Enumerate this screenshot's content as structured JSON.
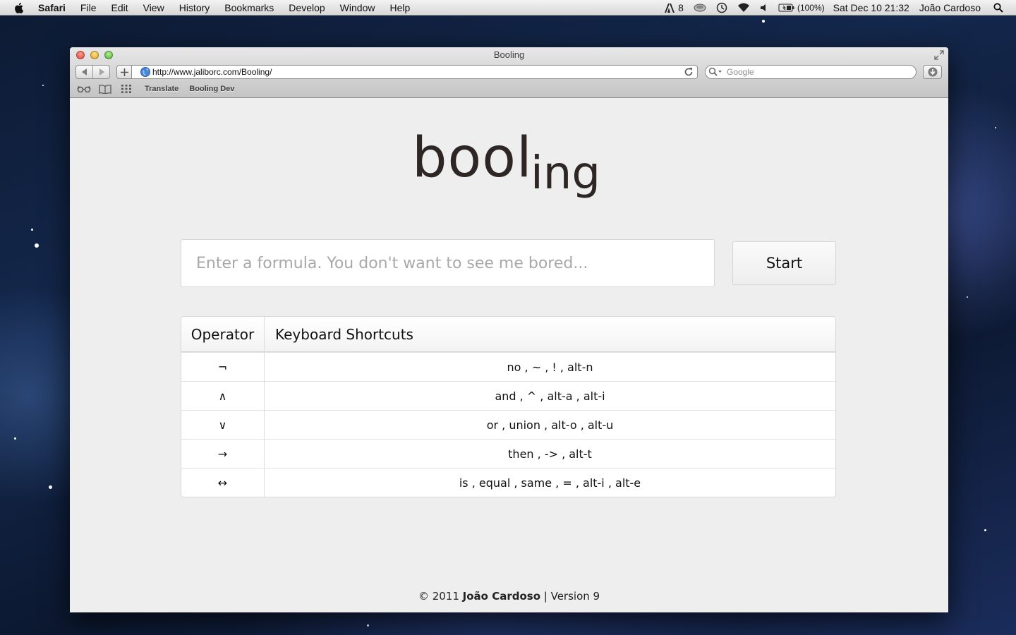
{
  "menubar": {
    "app_name": "Safari",
    "items": [
      "File",
      "Edit",
      "View",
      "History",
      "Bookmarks",
      "Develop",
      "Window",
      "Help"
    ],
    "status": {
      "adobe_count": "8",
      "battery": "(100%)",
      "clock": "Sat Dec 10  21:32",
      "user": "João Cardoso"
    }
  },
  "window": {
    "title": "Booling",
    "url": "http://www.jaliborc.com/Booling/",
    "search_placeholder": "Google",
    "bookmarks": [
      "Translate",
      "Booling Dev"
    ]
  },
  "page": {
    "logo_main": "bool",
    "logo_sub": "ing",
    "formula_placeholder": "Enter a formula. You don't want to see me bored...",
    "start_label": "Start",
    "table": {
      "headers": [
        "Operator",
        "Keyboard Shortcuts"
      ],
      "rows": [
        {
          "operator": "¬",
          "shortcuts": "no , ~ , ! , alt-n"
        },
        {
          "operator": "∧",
          "shortcuts": "and , ^ , alt-a , alt-i"
        },
        {
          "operator": "∨",
          "shortcuts": "or , union , alt-o , alt-u"
        },
        {
          "operator": "→",
          "shortcuts": "then , -> , alt-t"
        },
        {
          "operator": "↔",
          "shortcuts": "is , equal , same , = , alt-i , alt-e"
        }
      ]
    },
    "footer": {
      "copyright": "© 2011",
      "author": "João Cardoso",
      "version": "| Version 9"
    }
  }
}
